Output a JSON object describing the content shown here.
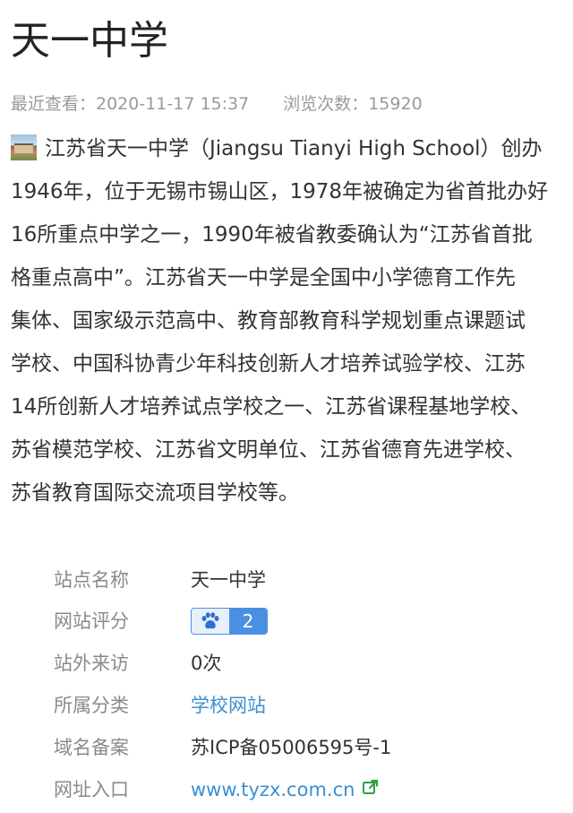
{
  "title": "天一中学",
  "meta": {
    "last_viewed": "最近查看：2020-11-17 15:37",
    "view_count": "浏览次数：15920"
  },
  "description": {
    "lines": [
      "江苏省天一中学（Jiangsu Tianyi High School）创办",
      "1946年，位于无锡市锡山区，1978年被确定为省首批办好",
      "16所重点中学之一，1990年被省教委确认为“江苏省首批",
      "格重点高中”。江苏省天一中学是全国中小学德育工作先",
      "集体、国家级示范高中、教育部教育科学规划重点课题试",
      "学校、中国科协青少年科技创新人才培养试验学校、江苏",
      "14所创新人才培养试点学校之一、江苏省课程基地学校、",
      "苏省模范学校、江苏省文明单位、江苏省德育先进学校、",
      "苏省教育国际交流项目学校等。"
    ]
  },
  "info": {
    "site_name": {
      "label": "站点名称",
      "value": "天一中学"
    },
    "rating": {
      "label": "网站评分",
      "score": "2",
      "icon": "paw-icon"
    },
    "visits": {
      "label": "站外来访",
      "value": "0次"
    },
    "category": {
      "label": "所属分类",
      "value": "学校网站"
    },
    "icp": {
      "label": "域名备案",
      "value": "苏ICP备05006595号-1"
    },
    "url": {
      "label": "网址入口",
      "value": "www.tyzx.com.cn",
      "icon": "external-link-icon"
    }
  },
  "colors": {
    "link": "#3a8fd0",
    "badge": "#4a90e2",
    "label": "#8a8a8a",
    "external_icon": "#2ea043"
  }
}
